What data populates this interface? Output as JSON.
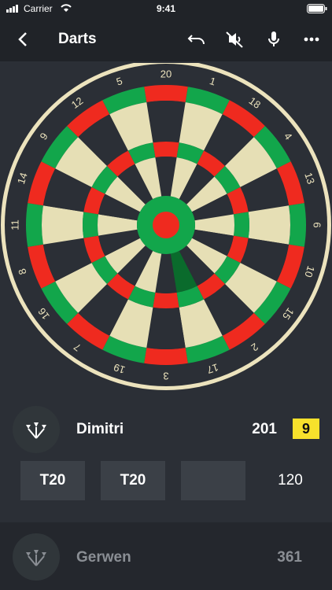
{
  "status": {
    "carrier": "Carrier",
    "time": "9:41"
  },
  "nav": {
    "title": "Darts",
    "icons": [
      "chevron-left-icon",
      "undo-icon",
      "mute-icon",
      "microphone-icon",
      "more-icon"
    ]
  },
  "board": {
    "numbers": [
      "20",
      "1",
      "18",
      "4",
      "13",
      "6",
      "10",
      "15",
      "2",
      "17",
      "3",
      "19",
      "7",
      "16",
      "8",
      "11",
      "14",
      "9",
      "12",
      "5"
    ],
    "colors": {
      "ring": "#ece3bd",
      "dark": "#2b2f36",
      "cream": "#e6dfb5",
      "red": "#ef2a1f",
      "green": "#12a64b",
      "highlight": "#0a6b2c"
    }
  },
  "players": [
    {
      "name": "Dimitri",
      "score": "201",
      "darts_left": "9",
      "throws": [
        "T20",
        "T20",
        ""
      ],
      "turn_total": "120"
    },
    {
      "name": "Gerwen",
      "score": "361"
    }
  ]
}
